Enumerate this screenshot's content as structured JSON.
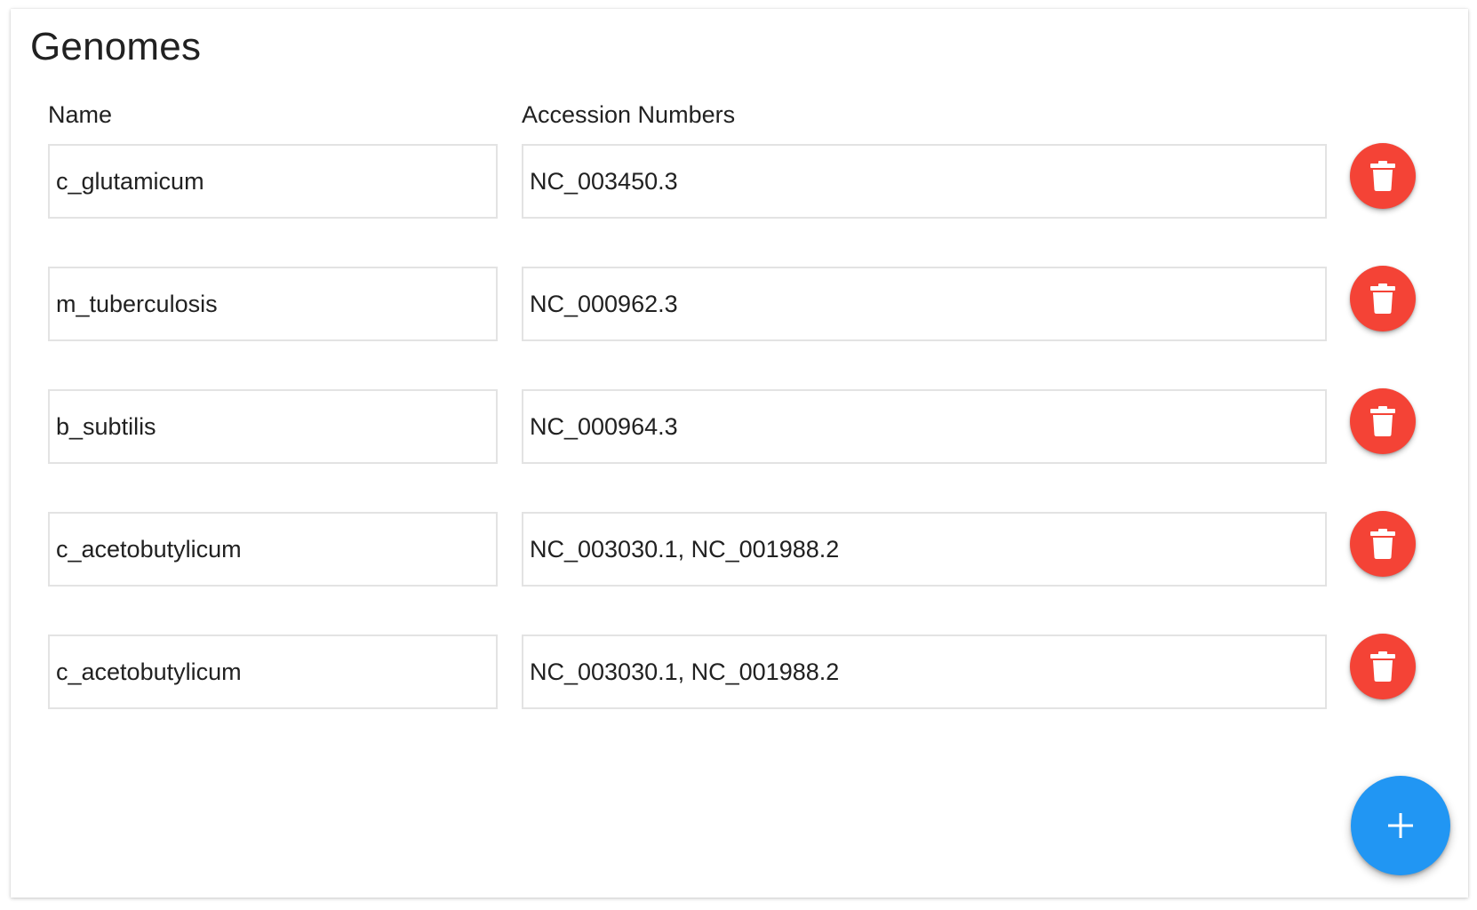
{
  "page": {
    "title": "Genomes"
  },
  "table": {
    "headers": {
      "name": "Name",
      "accession": "Accession Numbers"
    },
    "rows": [
      {
        "name": "c_glutamicum",
        "accession": "NC_003450.3"
      },
      {
        "name": "m_tuberculosis",
        "accession": "NC_000962.3"
      },
      {
        "name": "b_subtilis",
        "accession": "NC_000964.3"
      },
      {
        "name": "c_acetobutylicum",
        "accession": "NC_003030.1, NC_001988.2"
      },
      {
        "name": "c_acetobutylicum",
        "accession": "NC_003030.1, NC_001988.2"
      }
    ]
  },
  "icons": {
    "delete": "trash-icon",
    "add": "plus-icon"
  },
  "colors": {
    "delete_button": "#f44336",
    "add_button": "#2196f3",
    "field_border": "#e3e3e3"
  }
}
